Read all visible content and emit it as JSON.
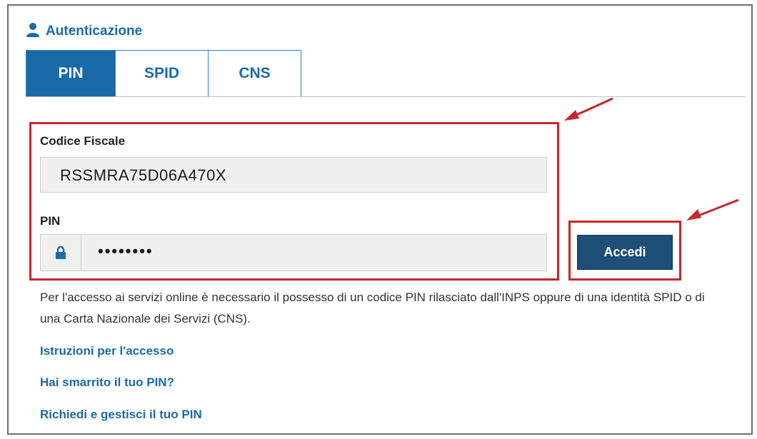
{
  "header": {
    "title": "Autenticazione",
    "icon": "user-icon"
  },
  "tabs": [
    {
      "label": "PIN",
      "active": true
    },
    {
      "label": "SPID",
      "active": false
    },
    {
      "label": "CNS",
      "active": false
    }
  ],
  "form": {
    "codice_fiscale_label": "Codice Fiscale",
    "codice_fiscale_value": "RSSMRA75D06A470X",
    "pin_label": "PIN",
    "pin_value": "••••••••",
    "pin_icon": "lock-icon",
    "submit_label": "Accedi"
  },
  "description": "Per l'accesso ai servizi online è necessario il possesso di un codice PIN rilasciato dall'INPS oppure di una identità SPID o di una Carta Nazionale dei Servizi (CNS).",
  "links": {
    "istruzioni": "Istruzioni per l'accesso",
    "smarrito": "Hai smarrito il tuo PIN?",
    "richiedi": "Richiedi e gestisci il tuo PIN"
  },
  "colors": {
    "accent": "#1a6aa8",
    "button": "#1d4f77",
    "highlight": "#c9262c"
  }
}
